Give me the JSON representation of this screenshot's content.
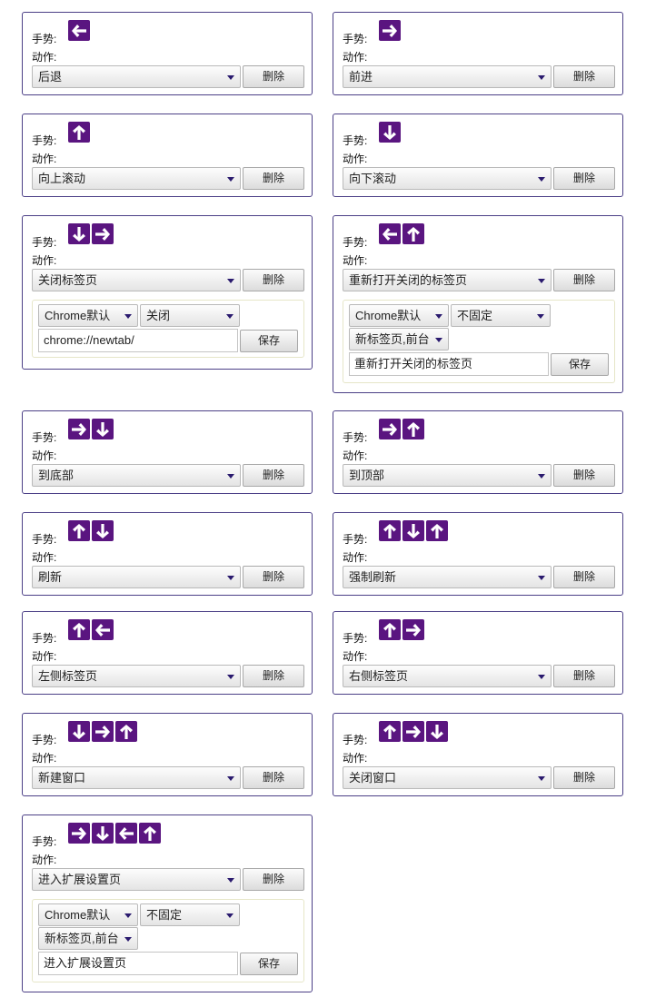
{
  "labels": {
    "gesture": "手势:",
    "action": "动作:",
    "delete": "删除",
    "save": "保存"
  },
  "icons": {
    "color": "#5a1580"
  },
  "cards": [
    {
      "gesture": [
        "left"
      ],
      "action": "后退"
    },
    {
      "gesture": [
        "right"
      ],
      "action": "前进"
    },
    {
      "gesture": [
        "up"
      ],
      "action": "向上滚动"
    },
    {
      "gesture": [
        "down"
      ],
      "action": "向下滚动"
    },
    {
      "gesture": [
        "down",
        "right"
      ],
      "action": "关闭标签页",
      "options": {
        "browser": "Chrome默认",
        "mode": "关闭",
        "url": "chrome://newtab/"
      }
    },
    {
      "gesture": [
        "left",
        "up"
      ],
      "action": "重新打开关闭的标签页",
      "options": {
        "browser": "Chrome默认",
        "mode": "不固定",
        "tab": "新标签页,前台",
        "url": "重新打开关闭的标签页"
      }
    },
    {
      "gesture": [
        "right",
        "down"
      ],
      "action": "到底部"
    },
    {
      "gesture": [
        "right",
        "up"
      ],
      "action": "到顶部"
    },
    {
      "gesture": [
        "up",
        "down"
      ],
      "action": "刷新"
    },
    {
      "gesture": [
        "up",
        "down",
        "up"
      ],
      "action": "强制刷新"
    },
    {
      "gesture": [
        "up",
        "left"
      ],
      "action": "左侧标签页"
    },
    {
      "gesture": [
        "up",
        "right"
      ],
      "action": "右侧标签页"
    },
    {
      "gesture": [
        "down",
        "right",
        "up"
      ],
      "action": "新建窗口"
    },
    {
      "gesture": [
        "up",
        "right",
        "down"
      ],
      "action": "关闭窗口"
    },
    {
      "gesture": [
        "right",
        "down",
        "left",
        "up"
      ],
      "action": "进入扩展设置页",
      "options": {
        "browser": "Chrome默认",
        "mode": "不固定",
        "tab": "新标签页,前台",
        "url": "进入扩展设置页"
      }
    }
  ]
}
